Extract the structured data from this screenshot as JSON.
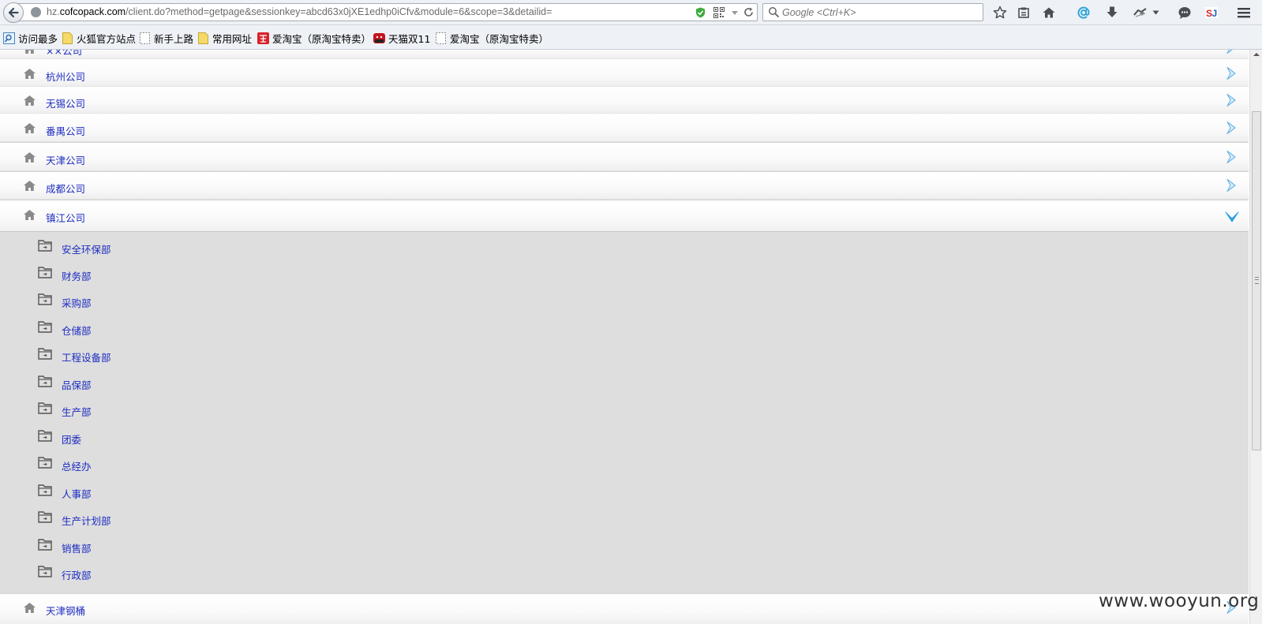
{
  "browser": {
    "url_prefix": "hz.",
    "url_domain": "cofcopack.com",
    "url_path": "/client.do?method=getpage&sessionkey=abcd63x0jXE1edhp0iCfv&module=6&scope=3&detailid=",
    "search_placeholder": "Google <Ctrl+K>"
  },
  "bookmarks": [
    {
      "label": "访问最多",
      "icon": "search-page-icon"
    },
    {
      "label": "火狐官方站点",
      "icon": "folder-icon"
    },
    {
      "label": "新手上路",
      "icon": "blank-page-icon"
    },
    {
      "label": "常用网址",
      "icon": "folder-icon"
    },
    {
      "label": "爱淘宝（原淘宝特卖）",
      "icon": "taobao-icon"
    },
    {
      "label": "天猫双11",
      "icon": "tmall-icon"
    },
    {
      "label": "爱淘宝（原淘宝特卖）",
      "icon": "blank-page-icon"
    }
  ],
  "companies": [
    {
      "label": "××公司"
    },
    {
      "label": "杭州公司"
    },
    {
      "label": "无锡公司"
    },
    {
      "label": "番禺公司"
    },
    {
      "label": "天津公司"
    },
    {
      "label": "成都公司"
    },
    {
      "label": "镇江公司",
      "expanded": true
    },
    {
      "label": "天津钢桶"
    }
  ],
  "departments": [
    {
      "label": "安全环保部"
    },
    {
      "label": "财务部"
    },
    {
      "label": "采购部"
    },
    {
      "label": "仓储部"
    },
    {
      "label": "工程设备部"
    },
    {
      "label": "品保部"
    },
    {
      "label": "生产部"
    },
    {
      "label": "团委"
    },
    {
      "label": "总经办"
    },
    {
      "label": "人事部"
    },
    {
      "label": "生产计划部"
    },
    {
      "label": "销售部"
    },
    {
      "label": "行政部"
    }
  ],
  "watermark": "www.wooyun.org",
  "colors": {
    "link": "#1d2cc1",
    "chevron": "#6fb7e6",
    "expanded_chevron": "#2b9ee6"
  }
}
